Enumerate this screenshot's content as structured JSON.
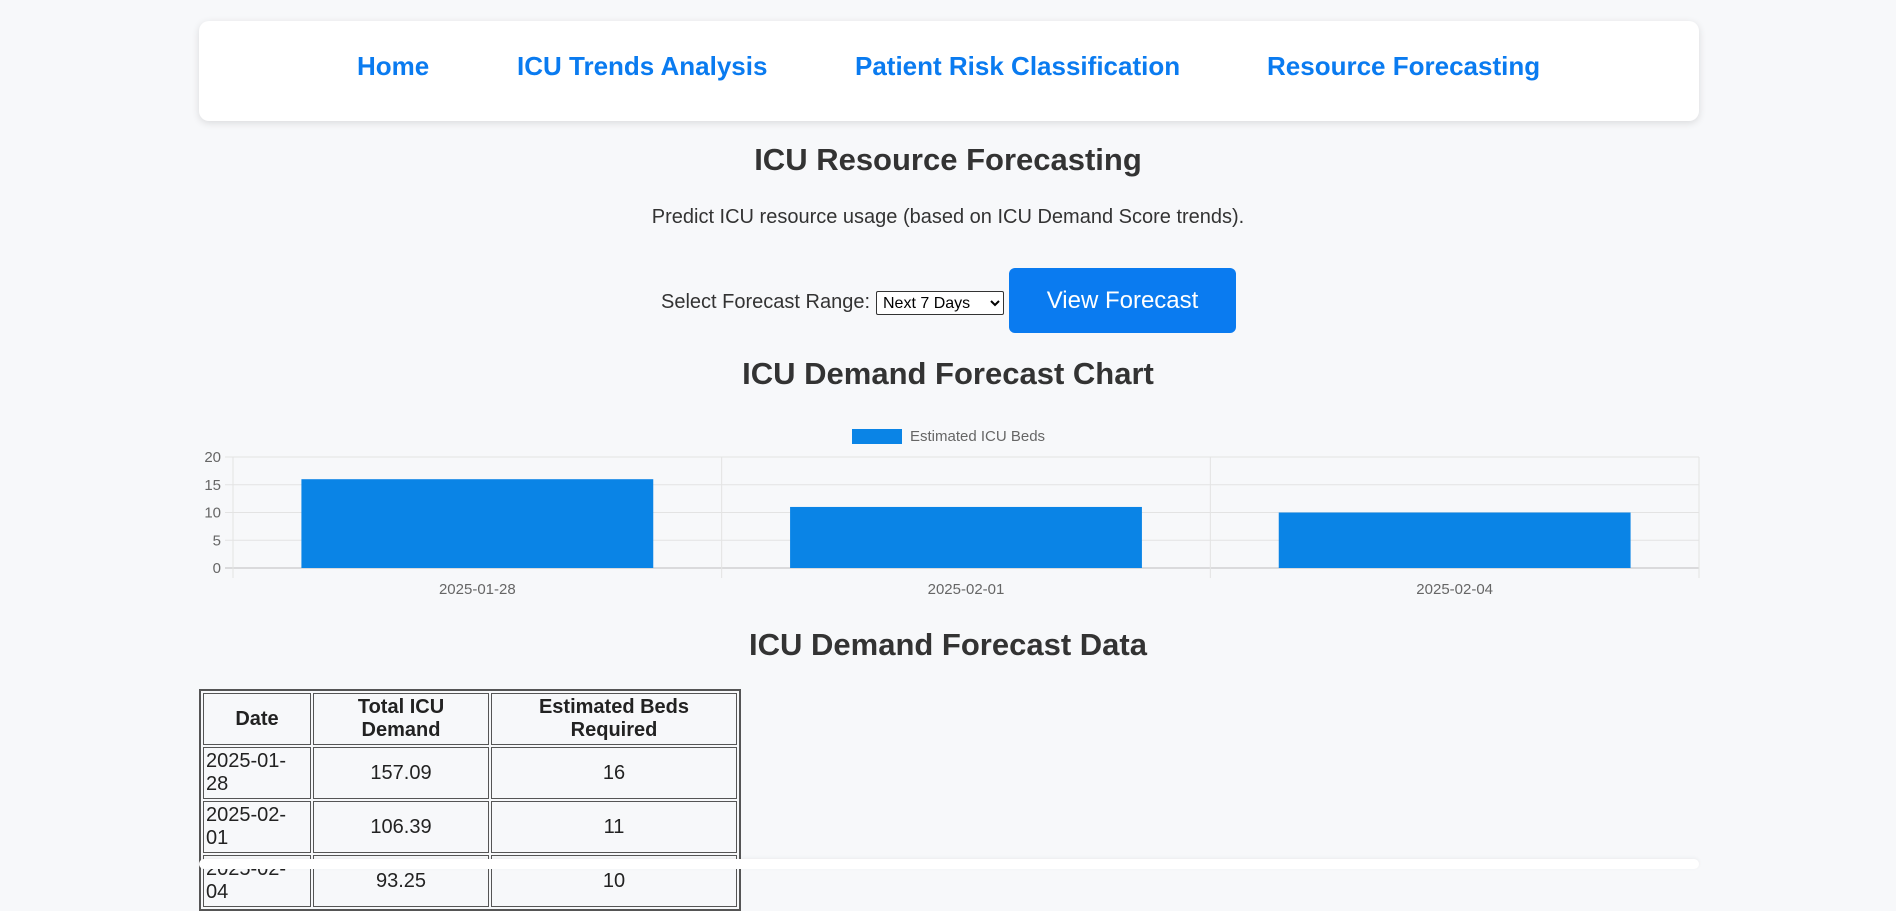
{
  "nav": {
    "items": [
      {
        "label": "Home"
      },
      {
        "label": "ICU Trends Analysis"
      },
      {
        "label": "Patient Risk Classification"
      },
      {
        "label": "Resource Forecasting"
      }
    ]
  },
  "page": {
    "title": "ICU Resource Forecasting",
    "subtitle": "Predict ICU resource usage (based on ICU Demand Score trends)."
  },
  "forecast_control": {
    "label": "Select Forecast Range:",
    "selected": "Next 7 Days",
    "button_label": "View Forecast"
  },
  "chart_section": {
    "title": "ICU Demand Forecast Chart"
  },
  "chart_data": {
    "type": "bar",
    "categories": [
      "2025-01-28",
      "2025-02-01",
      "2025-02-04"
    ],
    "series": [
      {
        "name": "Estimated ICU Beds",
        "values": [
          16,
          11,
          10
        ],
        "color": "#0a84e6"
      }
    ],
    "title": "",
    "xlabel": "",
    "ylabel": "",
    "ylim": [
      0,
      20
    ],
    "yticks": [
      0,
      5,
      10,
      15,
      20
    ],
    "grid": true,
    "legend": "top-center"
  },
  "table_section": {
    "title": "ICU Demand Forecast Data",
    "columns": [
      "Date",
      "Total ICU Demand",
      "Estimated Beds Required"
    ],
    "rows": [
      [
        "2025-01-28",
        "157.09",
        "16"
      ],
      [
        "2025-02-01",
        "106.39",
        "11"
      ],
      [
        "2025-02-04",
        "93.25",
        "10"
      ]
    ]
  },
  "colors": {
    "accent": "#0a7bf0",
    "bar": "#0a84e6",
    "background": "#f7f8fa"
  }
}
